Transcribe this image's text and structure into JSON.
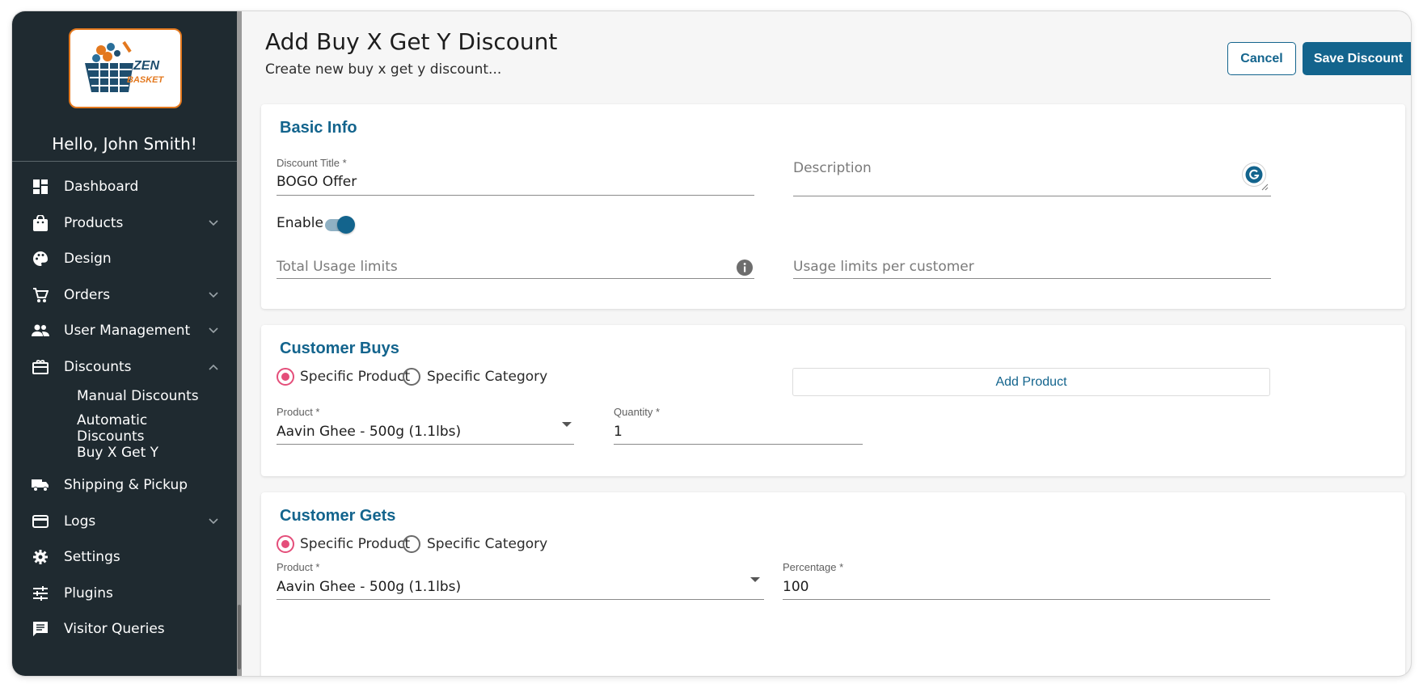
{
  "sidebar": {
    "greeting": "Hello, John Smith!",
    "logo_text": "ZEN BASKET",
    "items": [
      {
        "label": "Dashboard"
      },
      {
        "label": "Products"
      },
      {
        "label": "Design"
      },
      {
        "label": "Orders"
      },
      {
        "label": "User Management"
      },
      {
        "label": "Discounts"
      },
      {
        "label": "Shipping & Pickup"
      },
      {
        "label": "Logs"
      },
      {
        "label": "Settings"
      },
      {
        "label": "Plugins"
      },
      {
        "label": "Visitor Queries"
      }
    ],
    "discounts_sub": [
      "Manual Discounts",
      "Automatic Discounts",
      "Buy X Get Y"
    ]
  },
  "header": {
    "title": "Add Buy X Get Y Discount",
    "subtitle": "Create new buy x get y discount...",
    "cancel_label": "Cancel",
    "save_label": "Save Discount"
  },
  "basic_info": {
    "title": "Basic Info",
    "discount_title_label": "Discount Title *",
    "discount_title_value": "BOGO Offer",
    "description_placeholder": "Description",
    "enable_label": "Enable",
    "enable_on": true,
    "total_usage_placeholder": "Total Usage limits",
    "usage_per_customer_placeholder": "Usage limits per customer"
  },
  "customer_buys": {
    "title": "Customer Buys",
    "option_product": "Specific Product",
    "option_category": "Specific Category",
    "add_product_label": "Add Product",
    "product_label": "Product *",
    "product_value": "Aavin Ghee - 500g (1.1lbs)",
    "quantity_label": "Quantity *",
    "quantity_value": "1"
  },
  "customer_gets": {
    "title": "Customer Gets",
    "option_product": "Specific Product",
    "option_category": "Specific Category",
    "product_label": "Product *",
    "product_value": "Aavin Ghee - 500g (1.1lbs)",
    "percentage_label": "Percentage *",
    "percentage_value": "100"
  },
  "colors": {
    "accent": "#13648d",
    "sidebar_bg": "#1f2a30",
    "radio_selected": "#e44e7a",
    "logo_border": "#e3781e"
  }
}
